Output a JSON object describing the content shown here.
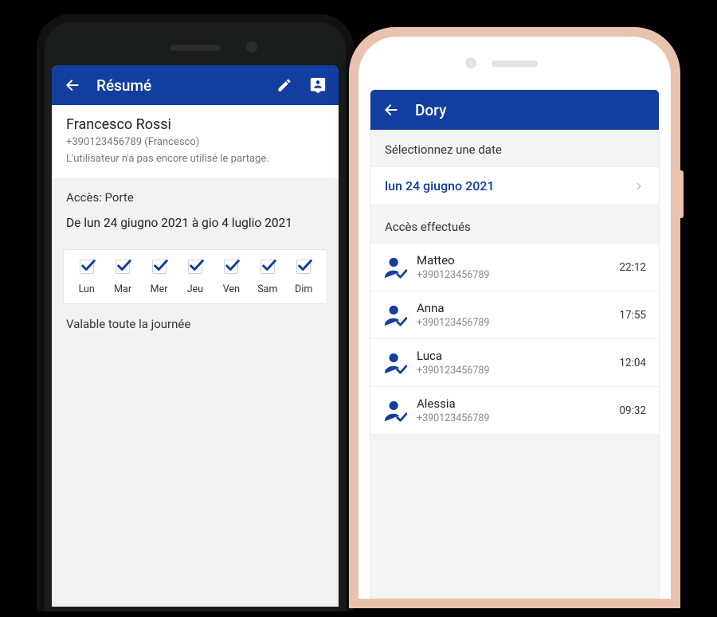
{
  "colors": {
    "brand": "#113E9F",
    "brand_light": "#1A4DBF"
  },
  "screenA": {
    "appbar": {
      "title": "Résumé"
    },
    "user": {
      "name": "Francesco Rossi",
      "sub": "+390123456789 (Francesco)",
      "note": "L'utilisateur n'a pas encore utilisé le partage."
    },
    "access_label": "Accès: Porte",
    "date_range": "De lun 24 giugno 2021 à gio 4 luglio 2021",
    "days": [
      {
        "label": "Lun",
        "checked": true
      },
      {
        "label": "Mar",
        "checked": true
      },
      {
        "label": "Mer",
        "checked": true
      },
      {
        "label": "Jeu",
        "checked": true
      },
      {
        "label": "Ven",
        "checked": true
      },
      {
        "label": "Sam",
        "checked": true
      },
      {
        "label": "Dim",
        "checked": true
      }
    ],
    "validity": "Valable toute la journée"
  },
  "screenB": {
    "appbar": {
      "title": "Dory"
    },
    "prompt": "Sélectionnez une date",
    "selected_date": "lun 24 giugno 2021",
    "section_title": "Accès effectués",
    "entries": [
      {
        "name": "Matteo",
        "phone": "+390123456789",
        "time": "22:12"
      },
      {
        "name": "Anna",
        "phone": "+390123456789",
        "time": "17:55"
      },
      {
        "name": "Luca",
        "phone": "+390123456789",
        "time": "12:04"
      },
      {
        "name": "Alessia",
        "phone": "+390123456789",
        "time": "09:32"
      }
    ]
  }
}
